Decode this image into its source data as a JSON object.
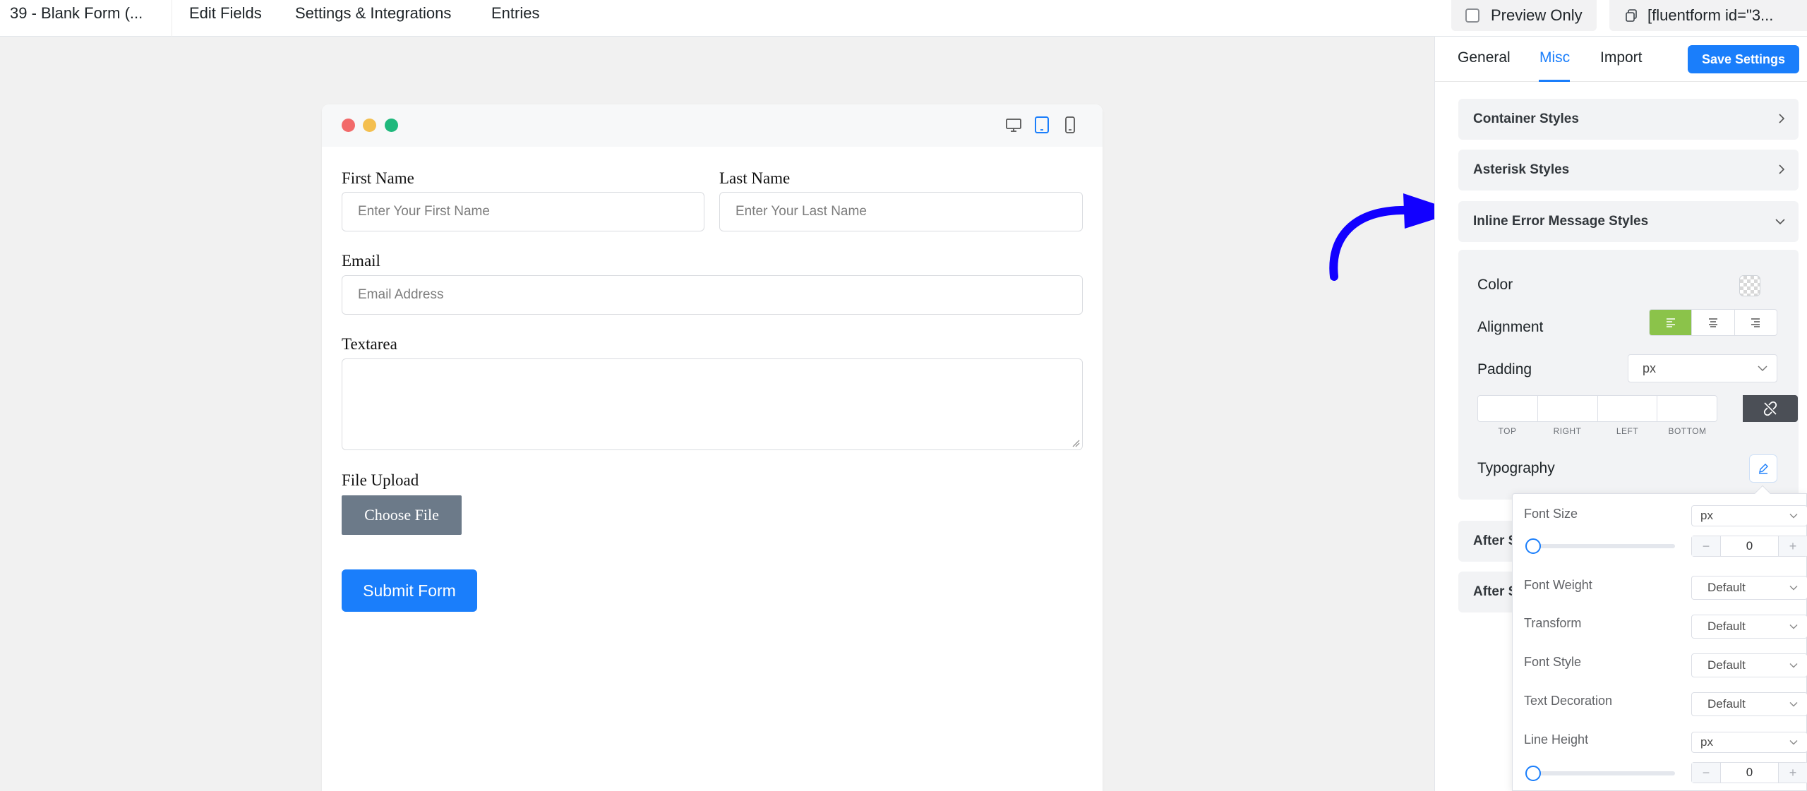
{
  "topbar": {
    "form_title": "39 - Blank Form (...",
    "nav": [
      "Edit Fields",
      "Settings & Integrations",
      "Entries"
    ],
    "preview_label": "Preview Only",
    "shortcode_label": "[fluentform id=\"3..."
  },
  "form": {
    "first_name_label": "First Name",
    "first_name_placeholder": "Enter Your First Name",
    "last_name_label": "Last Name",
    "last_name_placeholder": "Enter Your Last Name",
    "email_label": "Email",
    "email_placeholder": "Email Address",
    "textarea_label": "Textarea",
    "file_upload_label": "File Upload",
    "choose_file_label": "Choose File",
    "submit_label": "Submit Form"
  },
  "panel": {
    "tabs": [
      "General",
      "Misc",
      "Import"
    ],
    "active_tab": "Misc",
    "save_label": "Save Settings",
    "accordions": {
      "container": "Container Styles",
      "asterisk": "Asterisk Styles",
      "inline_error": "Inline Error Message Styles",
      "after_1": "After S",
      "after_2": "After S"
    },
    "inline_error": {
      "color_label": "Color",
      "alignment_label": "Alignment",
      "alignment_selected": "left",
      "padding_label": "Padding",
      "padding_unit": "px",
      "padding_captions": [
        "TOP",
        "RIGHT",
        "LEFT",
        "BOTTOM"
      ],
      "typography_label": "Typography"
    }
  },
  "typography": {
    "font_size_label": "Font Size",
    "font_size_unit": "px",
    "font_size_value": "0",
    "font_weight_label": "Font Weight",
    "font_weight_value": "Default",
    "transform_label": "Transform",
    "transform_value": "Default",
    "font_style_label": "Font Style",
    "font_style_value": "Default",
    "text_decoration_label": "Text Decoration",
    "text_decoration_value": "Default",
    "line_height_label": "Line Height",
    "line_height_unit": "px",
    "line_height_value": "0",
    "minus": "−",
    "plus": "+"
  },
  "colors": {
    "accent": "#1a7efb",
    "active_align": "#8bc34a",
    "arrow": "#1200ff",
    "file_button": "#6c7a89"
  },
  "icons": [
    "desktop-icon",
    "tablet-icon",
    "mobile-icon",
    "copy-icon",
    "chevron-right-icon",
    "chevron-down-icon",
    "align-left-icon",
    "align-center-icon",
    "align-right-icon",
    "unlink-icon",
    "edit-pen-icon"
  ]
}
